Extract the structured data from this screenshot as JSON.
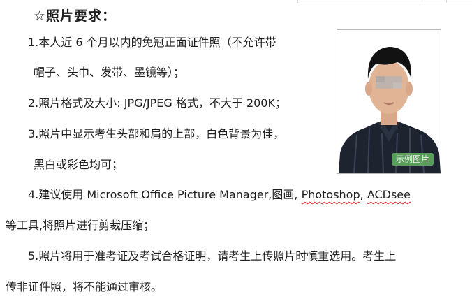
{
  "heading": "☆照片要求：",
  "items": {
    "i1_a": "1.本人近 6 个月以内的免冠正面证件照（不允许带",
    "i1_b": "帽子、头巾、发带、墨镜等）；",
    "i2": "2.照片格式及大小: JPG/JPEG 格式，不大于 200K；",
    "i3_a": "3.照片中显示考生头部和肩的上部，白色背景为佳，",
    "i3_b": "黑白或彩色均可；",
    "i4_pre": "4.建议使用 Microsoft Office Picture Manager,图画,",
    "i4_photoshop": "Photoshop",
    "i4_sep": ",",
    "i4_acdsee": "ACDsee",
    "i4_b": "等工具,将照片进行剪裁压缩；",
    "i5_a": "5.照片将用于准考证及考试合格证明，请考生上传照片时慎重选用。考生上",
    "i5_b": "传非证件照，将不能通过审核。"
  },
  "photo": {
    "badge": "示例图片"
  },
  "colors": {
    "text": "#1f1f1f",
    "spellcheck_underline": "#e0302a",
    "badge_bg": "#5ea85e"
  }
}
